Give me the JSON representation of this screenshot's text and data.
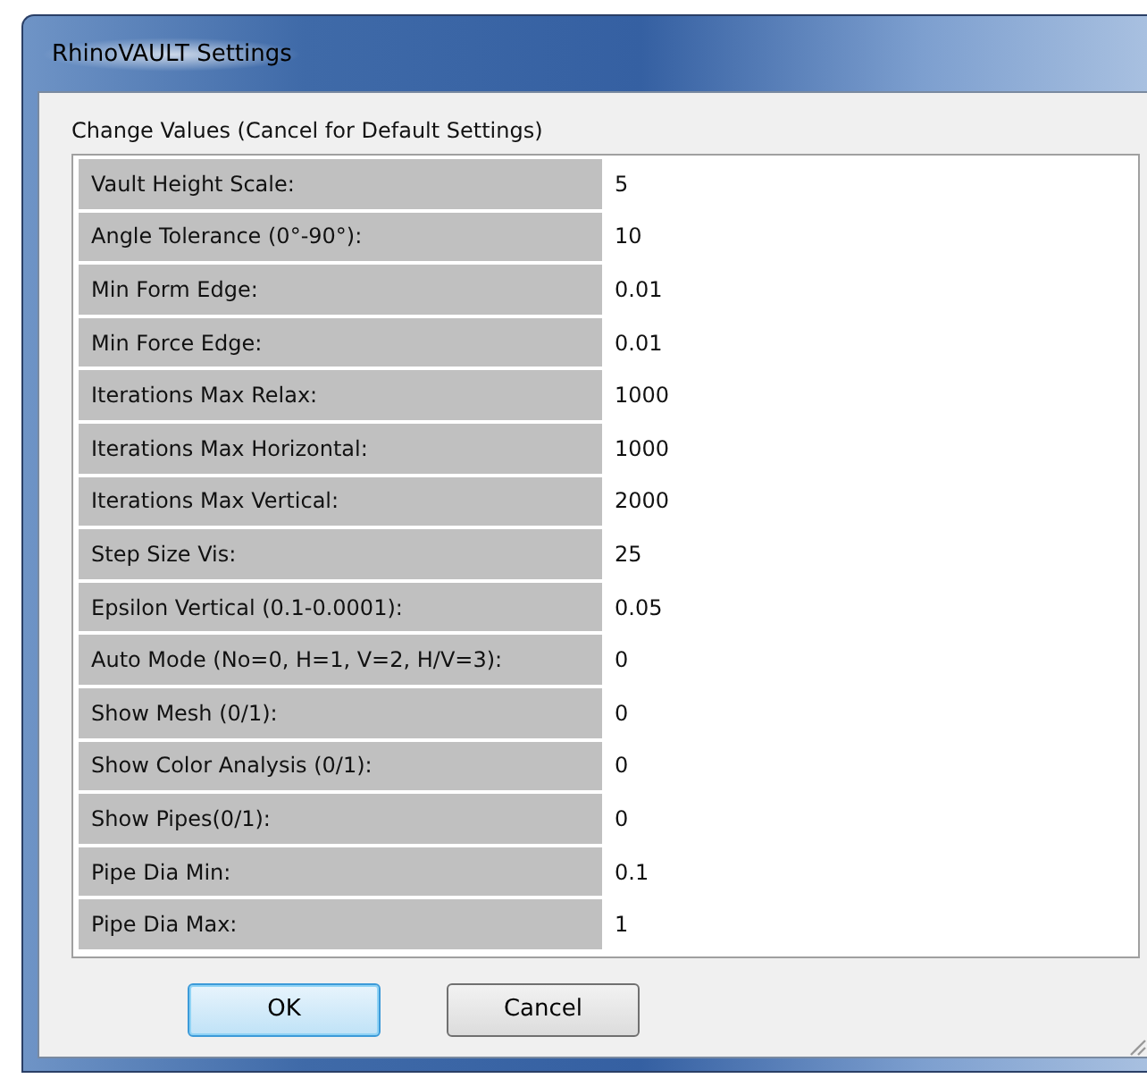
{
  "window": {
    "title": "RhinoVAULT Settings"
  },
  "heading": "Change Values (Cancel for Default Settings)",
  "rows": [
    {
      "label": "Vault Height Scale:",
      "value": "5"
    },
    {
      "label": "Angle Tolerance (0°-90°):",
      "value": "10"
    },
    {
      "label": "Min Form Edge:",
      "value": "0.01"
    },
    {
      "label": "Min Force Edge:",
      "value": "0.01"
    },
    {
      "label": "Iterations Max Relax:",
      "value": "1000"
    },
    {
      "label": "Iterations Max Horizontal:",
      "value": "1000"
    },
    {
      "label": "Iterations Max Vertical:",
      "value": "2000"
    },
    {
      "label": "Step Size Vis:",
      "value": "25"
    },
    {
      "label": "Epsilon Vertical (0.1-0.0001):",
      "value": "0.05"
    },
    {
      "label": "Auto Mode (No=0, H=1, V=2, H/V=3):",
      "value": "0"
    },
    {
      "label": "Show Mesh (0/1):",
      "value": "0"
    },
    {
      "label": "Show Color Analysis (0/1):",
      "value": "0"
    },
    {
      "label": "Show Pipes(0/1):",
      "value": "0"
    },
    {
      "label": "Pipe Dia Min:",
      "value": "0.1"
    },
    {
      "label": "Pipe Dia Max:",
      "value": "1"
    }
  ],
  "buttons": [
    {
      "label": "OK",
      "default": true
    },
    {
      "label": "Cancel",
      "default": false
    }
  ]
}
